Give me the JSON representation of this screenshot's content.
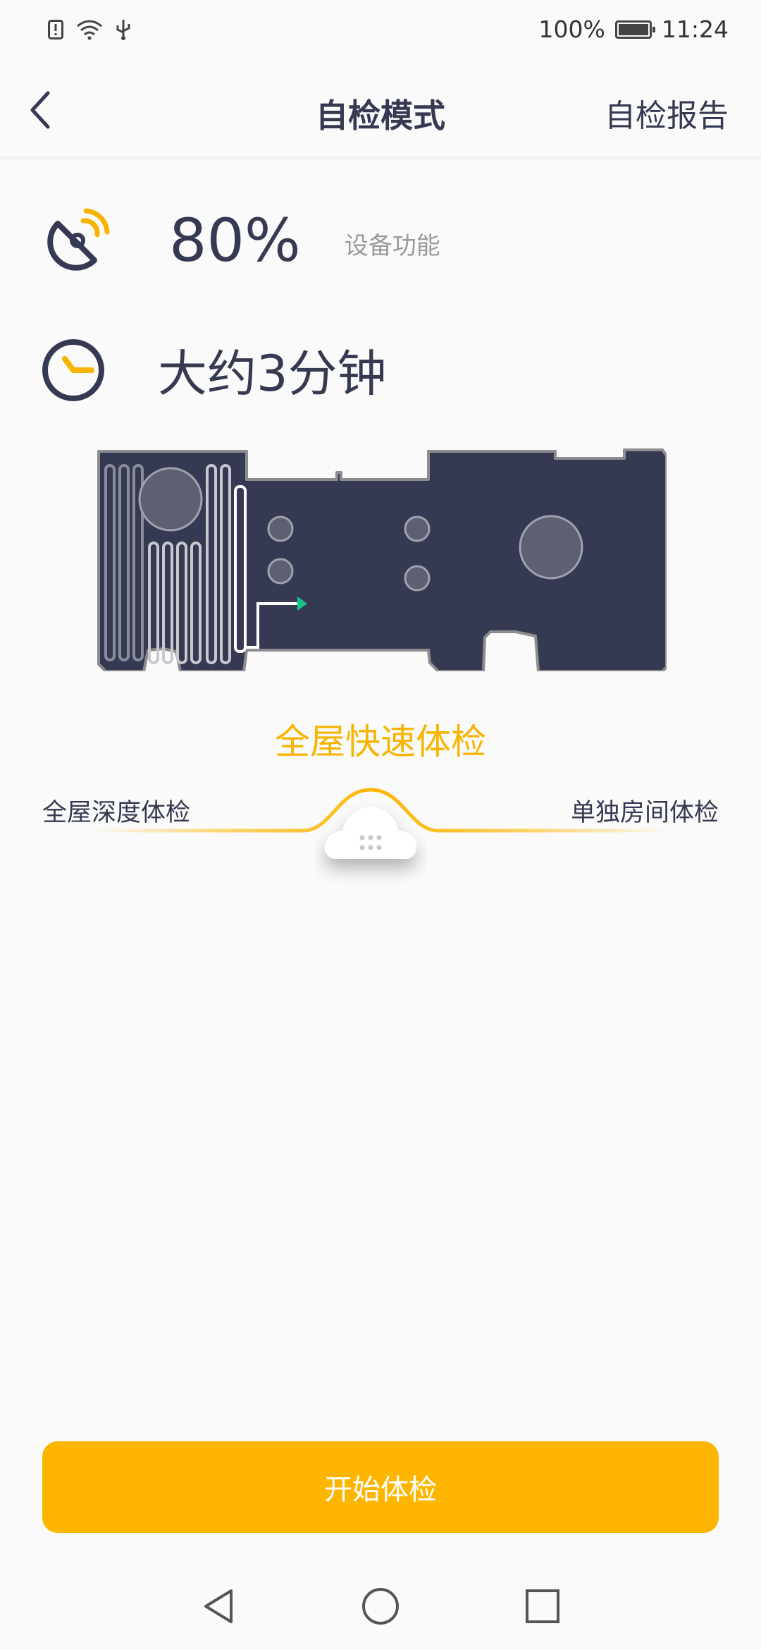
{
  "status_bar": {
    "battery_text": "100%",
    "battery_level": 1.0,
    "time": "11:24",
    "icons": [
      "alert-card-icon",
      "wifi-icon",
      "usb-icon",
      "battery-charging-icon"
    ]
  },
  "header": {
    "title": "自检模式",
    "report_link": "自检报告",
    "back_icon": "chevron-left-icon"
  },
  "stats": {
    "function_percent": "80%",
    "function_label": "设备功能",
    "function_icon": "satellite-dish-icon",
    "duration_text": "大约3分钟",
    "duration_icon": "clock-icon"
  },
  "map": {
    "icon": "floor-plan-icon"
  },
  "mode": {
    "selected": "全屋快速体检",
    "left_option": "全屋深度体检",
    "right_option": "单独房间体检"
  },
  "actions": {
    "start_label": "开始体检"
  },
  "nav": {
    "icons": [
      "back-triangle-icon",
      "home-circle-icon",
      "recents-square-icon"
    ]
  },
  "colors": {
    "accent": "#fdb500",
    "accent_text": "#f7b400",
    "primary_text": "#353a52",
    "secondary_text": "#9a9a9a",
    "map_fill": "#353a52",
    "map_stroke": "#8d8d8f",
    "robot_arrow": "#19c28c"
  }
}
